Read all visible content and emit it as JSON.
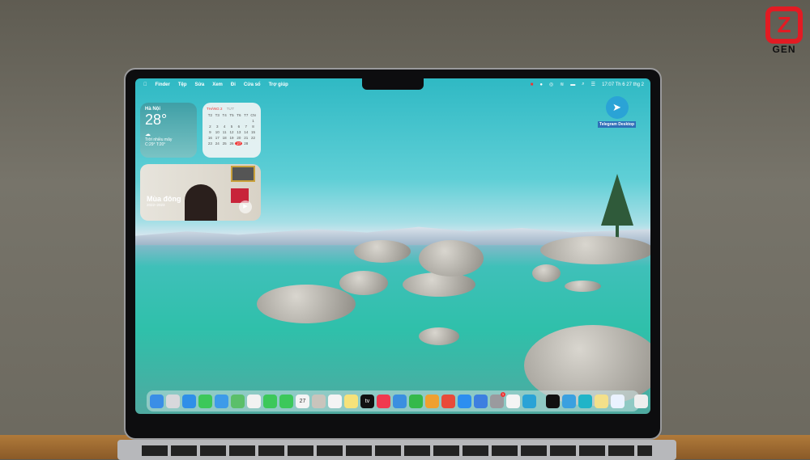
{
  "menubar": {
    "apple": "",
    "items": [
      "Finder",
      "Tệp",
      "Sửa",
      "Xem",
      "Đi",
      "Cửa sổ",
      "Trợ giúp"
    ],
    "clock": "17:07 Th 6 27 thg 2"
  },
  "weather": {
    "city": "Hà Nội",
    "temp": "28°",
    "condition": "Trời nhiều mây",
    "range": "C:29° T:20°"
  },
  "calendar": {
    "month": "THÁNG 2",
    "extra": "TƯT",
    "weekdays": [
      "T2",
      "T3",
      "T4",
      "T5",
      "T6",
      "T7",
      "CN"
    ],
    "days": [
      "",
      "",
      "",
      "",
      "",
      "",
      "1",
      "2",
      "3",
      "4",
      "5",
      "6",
      "7",
      "8",
      "9",
      "10",
      "11",
      "12",
      "13",
      "14",
      "15",
      "16",
      "17",
      "18",
      "19",
      "20",
      "21",
      "22",
      "23",
      "24",
      "25",
      "26",
      "27",
      "28",
      ""
    ],
    "today": "27"
  },
  "photo_widget": {
    "title": "Mùa đông",
    "subtitle": "2022–2023"
  },
  "desktop_icon": {
    "label": "Telegram Desktop"
  },
  "dock": {
    "apps": [
      {
        "name": "finder",
        "color": "#3a8ee6"
      },
      {
        "name": "launchpad",
        "color": "#d8d8dc"
      },
      {
        "name": "safari",
        "color": "#2f8fe8"
      },
      {
        "name": "messages",
        "color": "#3cc85a"
      },
      {
        "name": "mail",
        "color": "#3d9be9"
      },
      {
        "name": "maps",
        "color": "#5bbf6a"
      },
      {
        "name": "photos",
        "color": "#f2f2f2"
      },
      {
        "name": "facetime",
        "color": "#3cc85a"
      },
      {
        "name": "phone",
        "color": "#3cc85a"
      },
      {
        "name": "calendar",
        "color": "#f4f4f4",
        "label": "27"
      },
      {
        "name": "contacts",
        "color": "#c9c4bc"
      },
      {
        "name": "reminders",
        "color": "#f4f4f4"
      },
      {
        "name": "notes",
        "color": "#f6e27a"
      },
      {
        "name": "tv",
        "color": "#111111",
        "label": "tv"
      },
      {
        "name": "music",
        "color": "#f0394f"
      },
      {
        "name": "keynote",
        "color": "#3b8fe0"
      },
      {
        "name": "numbers",
        "color": "#35b94a"
      },
      {
        "name": "pages",
        "color": "#f0a030"
      },
      {
        "name": "rocket",
        "color": "#e84a3a"
      },
      {
        "name": "app-store",
        "color": "#2c8ef0"
      },
      {
        "name": "files",
        "color": "#3d7fe0"
      },
      {
        "name": "system-settings",
        "color": "#9a9a9e",
        "badge": "1"
      },
      {
        "name": "chrome",
        "color": "#f4f4f4"
      },
      {
        "name": "telegram",
        "color": "#2aa3d6"
      }
    ],
    "recent": [
      {
        "name": "terminal",
        "color": "#111111"
      },
      {
        "name": "app",
        "color": "#3aa0e0"
      },
      {
        "name": "canva",
        "color": "#1fb4c8"
      },
      {
        "name": "app2",
        "color": "#f3e08a"
      },
      {
        "name": "zalo",
        "color": "#eaf2ff"
      }
    ],
    "end": [
      {
        "name": "document",
        "color": "#eeeeee"
      },
      {
        "name": "trash",
        "color": "#d8d8d8"
      }
    ]
  },
  "watermark": {
    "text": "GEN"
  }
}
